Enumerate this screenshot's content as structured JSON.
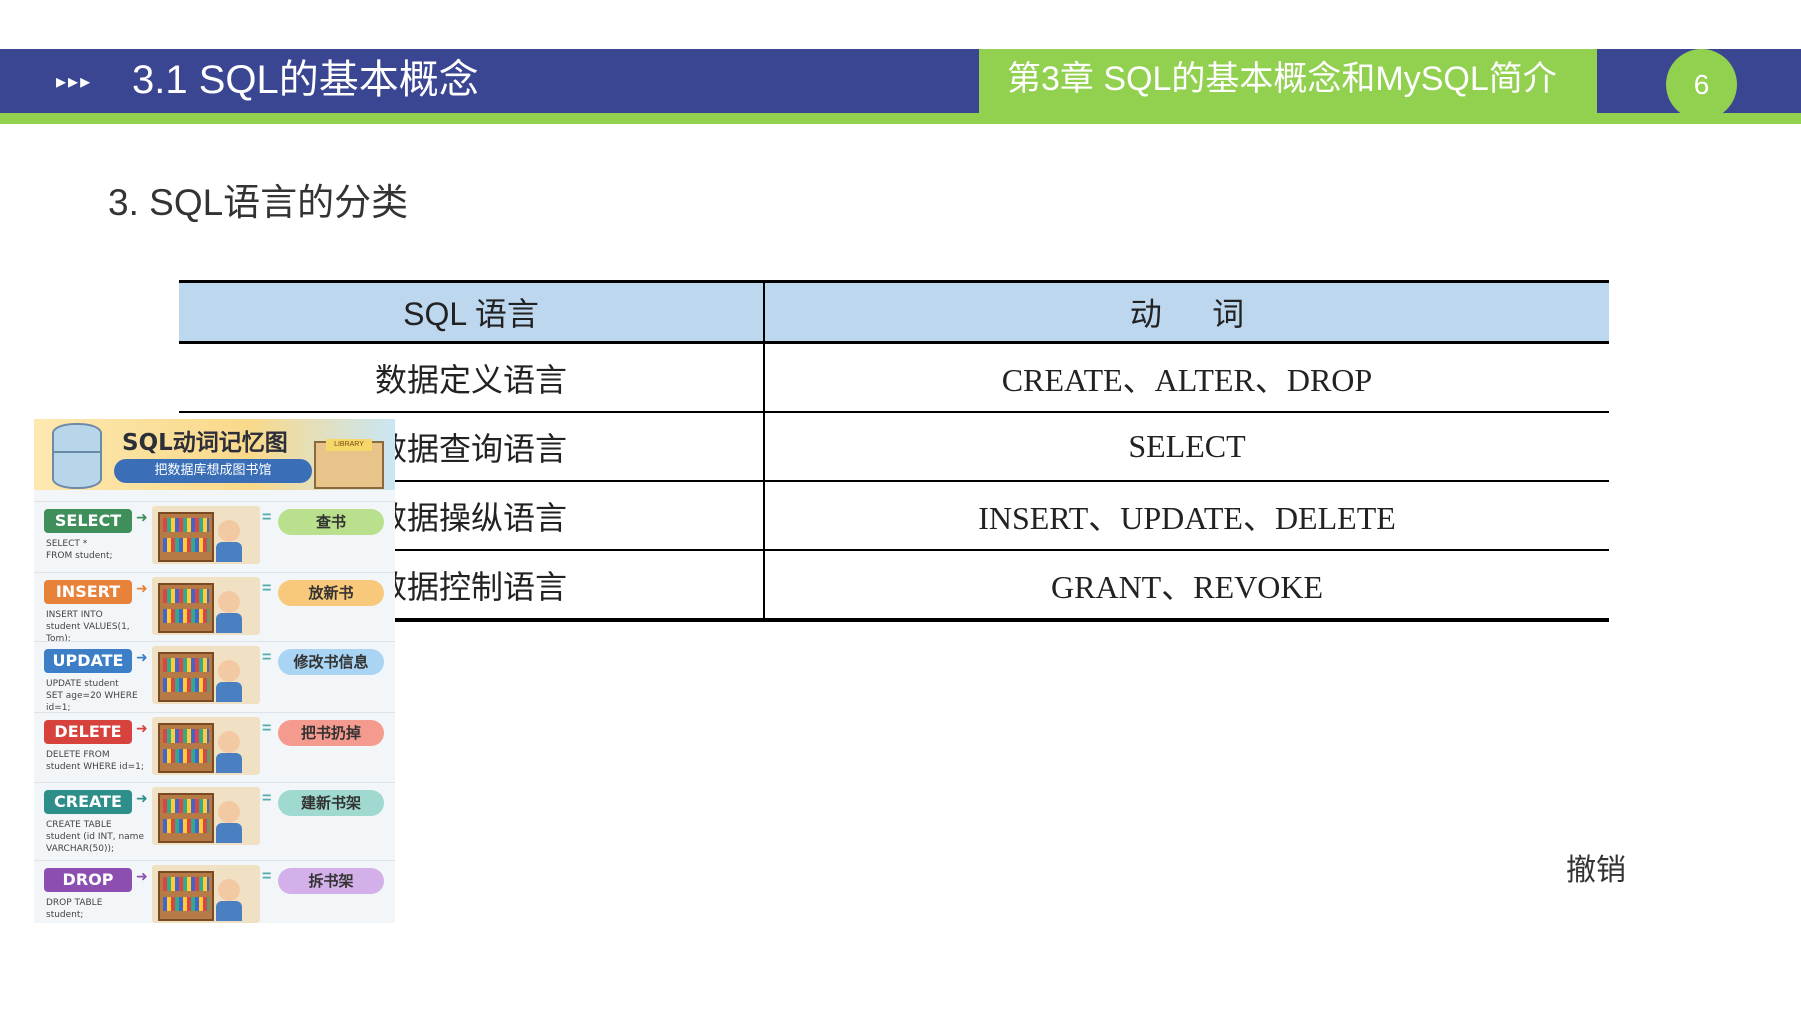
{
  "header": {
    "arrows": "▸▸▸",
    "title": "3.1  SQL的基本概念",
    "chapter": "第3章   SQL的基本概念和MySQL简介",
    "page_number": "6"
  },
  "section_title": "3. SQL语言的分类",
  "table": {
    "headers": [
      "SQL 语言",
      "动 词"
    ],
    "rows": [
      {
        "language": "数据定义语言",
        "verbs": "CREATE、ALTER、DROP"
      },
      {
        "language": "数据查询语言",
        "verbs": "SELECT"
      },
      {
        "language": "数据操纵语言",
        "verbs": "INSERT、UPDATE、DELETE"
      },
      {
        "language": "数据控制语言",
        "verbs": "GRANT、REVOKE"
      }
    ]
  },
  "infographic": {
    "title": "SQL动词记忆图",
    "subtitle": "把数据库想成图书馆",
    "library_tag": "LIBRARY",
    "rows": [
      {
        "verb": "SELECT",
        "code": "SELECT *\nFROM student;",
        "meaning": "查书",
        "color": "#3f8f5a",
        "pill": "#b9e08c"
      },
      {
        "verb": "INSERT",
        "code": "INSERT INTO\nstudent VALUES(1, Tom);",
        "meaning": "放新书",
        "color": "#e8823a",
        "pill": "#f8c97a"
      },
      {
        "verb": "UPDATE",
        "code": "UPDATE student\nSET age=20 WHERE id=1;",
        "meaning": "修改书信息",
        "color": "#3c7fc6",
        "pill": "#a9d4f3"
      },
      {
        "verb": "DELETE",
        "code": "DELETE FROM\nstudent WHERE id=1;",
        "meaning": "把书扔掉",
        "color": "#d8423c",
        "pill": "#f59a8f"
      },
      {
        "verb": "CREATE",
        "code": "CREATE TABLE\nstudent (id INT, name\nVARCHAR(50));",
        "meaning": "建新书架",
        "color": "#2e8f8a",
        "pill": "#9fd9cf"
      },
      {
        "verb": "DROP",
        "code": "DROP TABLE\nstudent;",
        "meaning": "拆书架",
        "color": "#8c4fb0",
        "pill": "#d3b0ea"
      }
    ]
  },
  "side_note": "撤销"
}
